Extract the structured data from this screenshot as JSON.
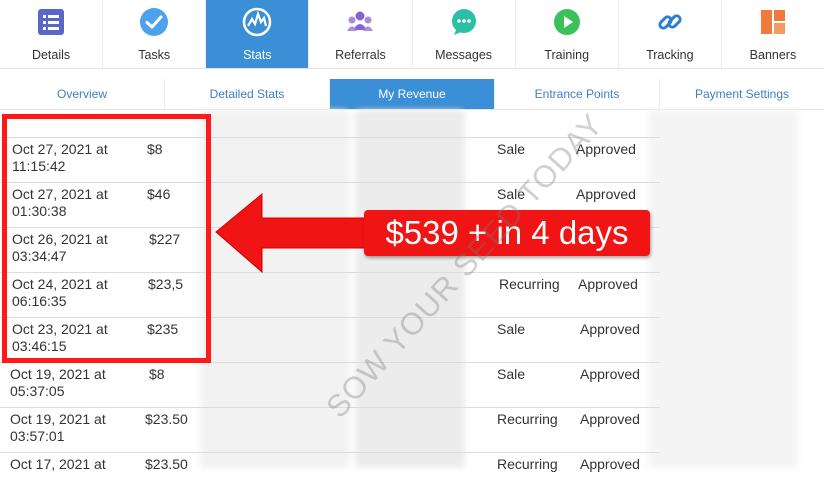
{
  "nav": {
    "items": [
      {
        "label": "Details",
        "icon": "list-icon",
        "active": false
      },
      {
        "label": "Tasks",
        "icon": "checkmark-icon",
        "active": false
      },
      {
        "label": "Stats",
        "icon": "chart-icon",
        "active": true
      },
      {
        "label": "Referrals",
        "icon": "people-icon",
        "active": false
      },
      {
        "label": "Messages",
        "icon": "chat-icon",
        "active": false
      },
      {
        "label": "Training",
        "icon": "play-icon",
        "active": false
      },
      {
        "label": "Tracking",
        "icon": "link-icon",
        "active": false
      },
      {
        "label": "Banners",
        "icon": "layout-icon",
        "active": false
      }
    ]
  },
  "subnav": {
    "items": [
      {
        "label": "Overview",
        "active": false
      },
      {
        "label": "Detailed Stats",
        "active": false
      },
      {
        "label": "My Revenue",
        "active": true
      },
      {
        "label": "Entrance Points",
        "active": false
      },
      {
        "label": "Payment Settings",
        "active": false
      }
    ]
  },
  "table": {
    "rows": [
      {
        "date": "Oct 27, 2021 at 11:15:42",
        "amount": "$8",
        "type": "Sale",
        "status": "Approved"
      },
      {
        "date": "Oct 27, 2021 at 01:30:38",
        "amount": "$46",
        "type": "Sale",
        "status": "Approved"
      },
      {
        "date": "Oct 26, 2021 at 03:34:47",
        "amount": "$227",
        "type": "",
        "status": ""
      },
      {
        "date": "Oct 24, 2021 at 06:16:35",
        "amount": "$23,5",
        "type": "Recurring",
        "status": "Approved"
      },
      {
        "date": "Oct 23, 2021 at 03:46:15",
        "amount": "$235",
        "type": "Sale",
        "status": "Approved"
      },
      {
        "date": "Oct 19, 2021 at 05:37:05",
        "amount": "$8",
        "type": "Sale",
        "status": "Approved"
      },
      {
        "date": "Oct 19, 2021 at 03:57:01",
        "amount": "$23.50",
        "type": "Recurring",
        "status": "Approved"
      },
      {
        "date": "Oct 17, 2021 at",
        "amount": "$23.50",
        "type": "Recurring",
        "status": "Approved"
      }
    ]
  },
  "callout": {
    "text": "$539 + in 4 days"
  },
  "watermark": {
    "text": "SOW YOUR SEED TODAY"
  },
  "colors": {
    "accent": "#3b8fd6",
    "highlight_red": "#f01414"
  }
}
